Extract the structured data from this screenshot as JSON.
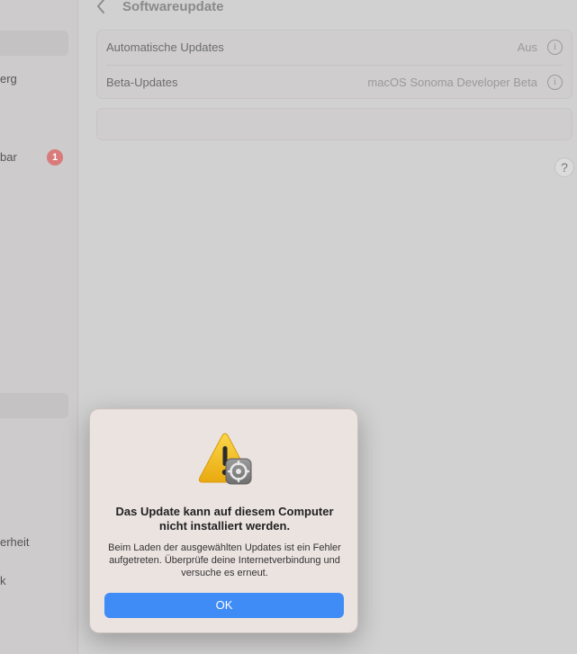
{
  "sidebar": {
    "items": [
      {
        "label": "erg"
      },
      {
        "label": "bar"
      },
      {
        "label": "erheit"
      },
      {
        "label": "k"
      }
    ],
    "badge": "1"
  },
  "header": {
    "title": "Softwareupdate"
  },
  "settings": {
    "rows": [
      {
        "label": "Automatische Updates",
        "value": "Aus"
      },
      {
        "label": "Beta-Updates",
        "value": "macOS Sonoma Developer Beta"
      }
    ]
  },
  "help": {
    "label": "?"
  },
  "dialog": {
    "title": "Das Update kann auf diesem Computer nicht installiert werden.",
    "message": "Beim Laden der ausgewählten Updates ist ein Fehler aufgetreten. Überprüfe deine Internetverbindung und versuche es erneut.",
    "ok_label": "OK",
    "icon": "warning-gear-icon"
  },
  "colors": {
    "accent": "#3f8cf7",
    "badge": "#d97b7b",
    "warning": "#f4c21b"
  }
}
